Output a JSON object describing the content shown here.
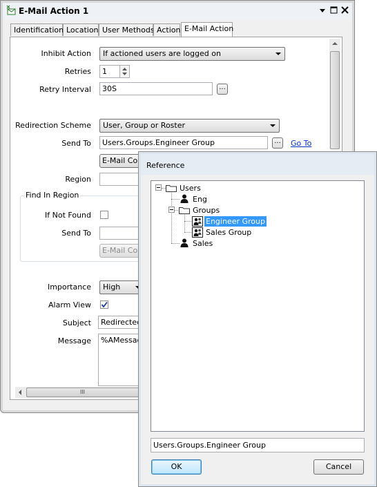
{
  "main_window": {
    "title": "E-Mail Action 1",
    "tabs": [
      "Identification",
      "Location",
      "User Methods",
      "Action",
      "E-Mail Action"
    ],
    "active_tab": "E-Mail Action",
    "fields": {
      "inhibit_action": {
        "label": "Inhibit Action",
        "value": "If actioned users are logged on"
      },
      "retries": {
        "label": "Retries",
        "value": "1"
      },
      "retry_interval": {
        "label": "Retry Interval",
        "value": "30S"
      },
      "redirection_scheme": {
        "label": "Redirection Scheme",
        "value": "User, Group or Roster"
      },
      "send_to": {
        "label": "Send To",
        "value": "Users.Groups.Engineer Group",
        "goto_label": "Go To"
      },
      "email_contact_button": "E-Mail Cont",
      "region": {
        "label": "Region",
        "value": ""
      },
      "find_in_region": {
        "group_label": "Find In Region",
        "if_not_found_label": "If Not Found",
        "if_not_found_checked": false,
        "send_to_label": "Send To",
        "send_to_value": "",
        "email_contact_button": "E-Mail Cont"
      },
      "importance": {
        "label": "Importance",
        "value": "High"
      },
      "alarm_view": {
        "label": "Alarm View",
        "checked": true
      },
      "subject": {
        "label": "Subject",
        "value": "Redirected"
      },
      "message": {
        "label": "Message",
        "value": "%AMessage"
      }
    },
    "browse_button": "...",
    "scroll_grip": "III"
  },
  "reference_dialog": {
    "title": "Reference",
    "tree": [
      {
        "label": "Users",
        "icon": "folder-icon"
      },
      {
        "label": "Eng",
        "icon": "user-icon"
      },
      {
        "label": "Groups",
        "icon": "folder-icon"
      },
      {
        "label": "Engineer Group",
        "icon": "group-icon",
        "selected": true
      },
      {
        "label": "Sales Group",
        "icon": "group-icon"
      },
      {
        "label": "Sales",
        "icon": "user-icon"
      }
    ],
    "path_value": "Users.Groups.Engineer Group",
    "ok_label": "OK",
    "cancel_label": "Cancel"
  },
  "colors": {
    "selection": "#3399ff",
    "link": "#0033cc"
  }
}
